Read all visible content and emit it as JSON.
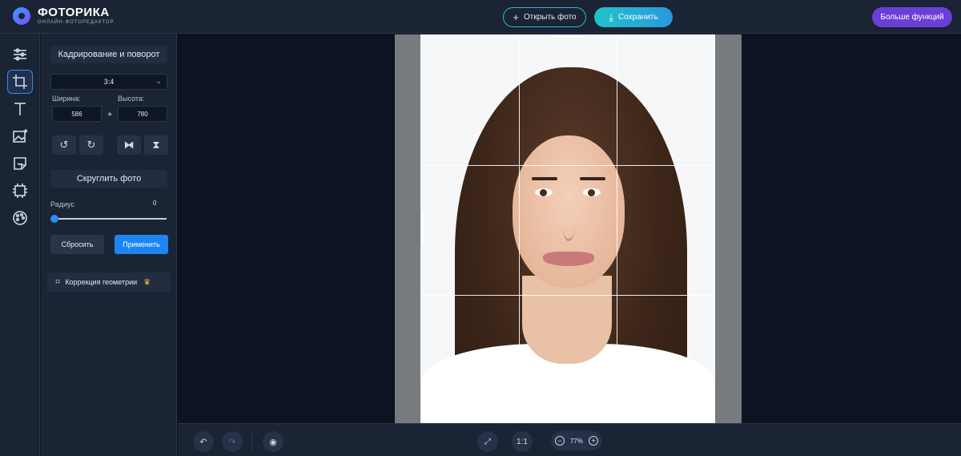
{
  "app": {
    "name": "ФОТОРИКА",
    "subtitle": "ОНЛАЙН-ФОТОРЕДАКТОР"
  },
  "topbar": {
    "open_label": "Открыть фото",
    "save_label": "Сохранить",
    "more_label": "Больше функций"
  },
  "rail": {
    "items": [
      {
        "icon": "sliders-icon",
        "active": false
      },
      {
        "icon": "crop-icon",
        "active": true
      },
      {
        "icon": "text-icon",
        "active": false
      },
      {
        "icon": "image-add-icon",
        "active": false
      },
      {
        "icon": "sticker-icon",
        "active": false
      },
      {
        "icon": "ai-chip-icon",
        "active": false
      },
      {
        "icon": "palette-icon",
        "active": false
      }
    ]
  },
  "panel": {
    "title": "Кадрирование и поворот",
    "ratio": "3:4",
    "width_label": "Ширина:",
    "width_value": "586",
    "height_label": "Высота:",
    "height_value": "780",
    "round_label": "Скруглить фото",
    "radius_label": "Радиус",
    "radius_value": "0",
    "reset_label": "Сбросить",
    "apply_label": "Применить",
    "geometry_label": "Коррекция геометрии"
  },
  "bottombar": {
    "ratio_label": "1:1",
    "zoom_value": "77%"
  },
  "colors": {
    "accent": "#1b86f2",
    "save_gradient_start": "#21c3c8",
    "more_bg": "#6a3fd6",
    "premium_crown": "#f5b82e"
  }
}
